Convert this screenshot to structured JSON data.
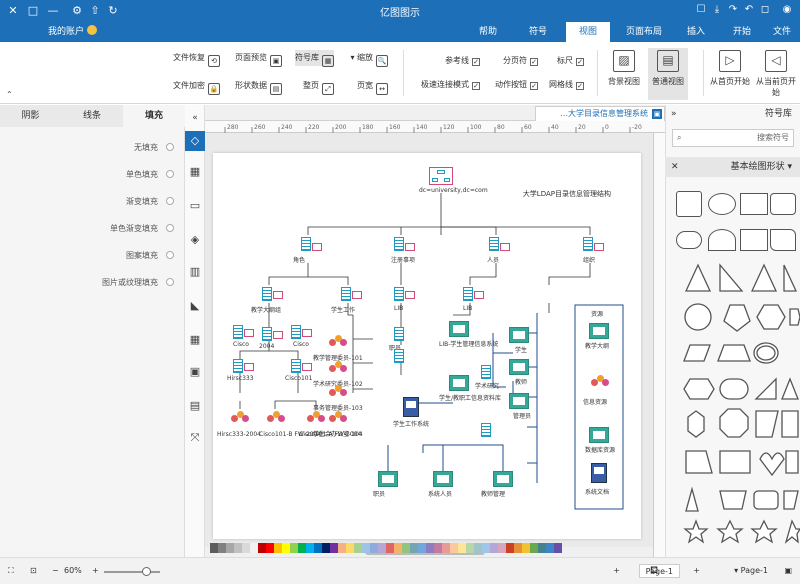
{
  "app": {
    "title": "亿图图示"
  },
  "titlebar": {
    "quick_icons": [
      "◻",
      "↶",
      "↷",
      "⤓",
      "☐"
    ],
    "controls": [
      "✕",
      "□",
      "—",
      "⚙",
      "⇧",
      "↻",
      "◉"
    ]
  },
  "ribbon_tabs": {
    "items": [
      "文件",
      "开始",
      "插入",
      "页面布局",
      "视图",
      "符号",
      "帮助"
    ],
    "active": "视图",
    "user_label": "我的账户"
  },
  "ribbon": {
    "big_buttons": [
      {
        "label": "从当前页开始",
        "icon": "◁"
      },
      {
        "label": "从首页开始",
        "icon": "▷"
      },
      {
        "label": "普通视图",
        "icon": "▤"
      },
      {
        "label": "背景视图",
        "icon": "▨"
      }
    ],
    "checkboxes": [
      {
        "label": "标尺",
        "checked": true
      },
      {
        "label": "网格线",
        "checked": true
      },
      {
        "label": "分页符",
        "checked": true
      },
      {
        "label": "动作按钮",
        "checked": true
      },
      {
        "label": "参考线",
        "checked": true
      },
      {
        "label": "极速连接模式",
        "checked": true
      }
    ],
    "small_buttons": [
      {
        "label": "缩放",
        "icon": "🔍"
      },
      {
        "label": "页宽",
        "icon": "↔"
      },
      {
        "label": "符号库",
        "icon": "▦"
      },
      {
        "label": "整页",
        "icon": "⤢"
      },
      {
        "label": "页面预览",
        "icon": "▣"
      },
      {
        "label": "形状数据",
        "icon": "▤"
      },
      {
        "label": "文件恢复",
        "icon": "⟲"
      },
      {
        "label": "文件加密",
        "icon": "🔒"
      }
    ]
  },
  "prop_panel": {
    "tabs": [
      "填充",
      "线条",
      "阴影"
    ],
    "active_tab": "填充",
    "fill_options": [
      "无填充",
      "单色填充",
      "渐变填充",
      "单色渐变填充",
      "图案填充",
      "图片或纹理填充"
    ]
  },
  "icon_strip": [
    "◇",
    "▦",
    "▭",
    "◈",
    "▥",
    "◣",
    "▦",
    "▣",
    "▤",
    "⤧",
    "»"
  ],
  "document": {
    "tab_label": "大学目录信息管理系统..."
  },
  "ruler_ticks": [
    "280",
    "260",
    "240",
    "220",
    "200",
    "180",
    "160",
    "140",
    "120",
    "100",
    "80",
    "60",
    "40",
    "20",
    "0",
    "-20"
  ],
  "diagram": {
    "title": "大学LDAP目录信息管理结构",
    "root": "dc=university,dc=com",
    "level1": [
      "组织",
      "人员",
      "角色",
      "注册事项"
    ],
    "level2": [
      "部门",
      "LIB",
      "LIB",
      "人员名单",
      "学生工作",
      "教学大纲组"
    ],
    "level3": [
      "2004",
      "Cisco",
      "Cisco",
      "Cisco101",
      "Hirsc333",
      "学术研究",
      "职员"
    ],
    "leaf_labels": [
      "2004-Hirsc333",
      "2004-Cisco101-B FW",
      "2004-Cisco101-A FW",
      "101-教学管理委员",
      "102-学术研究委员",
      "103-事务管理委员",
      "104-学生会办公室",
      "LIB-学生管理信息系统",
      "学生工作系统",
      "学生/教职工信息资料库",
      "学生",
      "教师",
      "管理员",
      "职员",
      "系统人员",
      "教师管理"
    ],
    "side_box_title": "资源",
    "side_box_items": [
      "教学大纲",
      "数据库资源",
      "信息资源",
      "系统文档"
    ]
  },
  "symbol_lib": {
    "header": "符号库",
    "search_placeholder": "搜索符号",
    "library_name": "基本绘图形状"
  },
  "status": {
    "page_label": "Page-1",
    "page_tab": "Page-1",
    "zoom": "60%"
  },
  "colors": {
    "accent": "#1d6fb8",
    "node_pink": "#d04a7a",
    "db_cyan": "#1f9ac0",
    "line_blue": "#1f4e8f"
  },
  "palette": [
    "#5c5c5c",
    "#808080",
    "#a6a6a6",
    "#c0c0c0",
    "#d9d9d9",
    "#f2f2f2",
    "#c00000",
    "#ff0000",
    "#ffc000",
    "#ffff00",
    "#92d050",
    "#00b050",
    "#00b0f0",
    "#0070c0",
    "#002060",
    "#7030a0",
    "#f4b183",
    "#ffd966",
    "#a9d18e",
    "#9dc3e6",
    "#8faadc",
    "#b4a7d6",
    "#e06666",
    "#f6b26b",
    "#93c47d",
    "#76a5af",
    "#6fa8dc",
    "#8e7cc3",
    "#c27ba0",
    "#ea9999",
    "#f9cb9c",
    "#ffe599",
    "#b6d7a8",
    "#a2c4c9",
    "#9fc5e8",
    "#b4a7d6",
    "#d5a6bd",
    "#cc4125",
    "#e69138",
    "#f1c232",
    "#6aa84f",
    "#45818e",
    "#3d85c6",
    "#674ea7"
  ]
}
